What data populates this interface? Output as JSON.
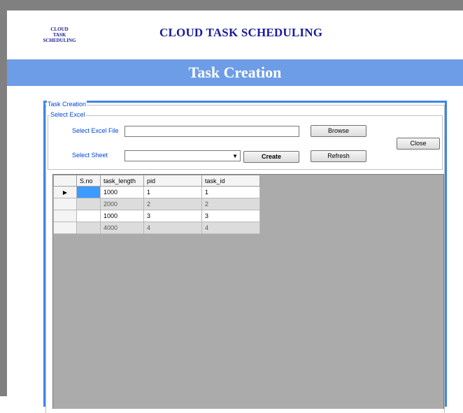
{
  "logo": {
    "lines": [
      "CLOUD",
      "TASK",
      "SCHEDULING"
    ]
  },
  "header": {
    "title": "CLOUD TASK SCHEDULING"
  },
  "banner": {
    "title": "Task Creation"
  },
  "window": {
    "group_title": "Task Creation",
    "select_excel_group": "Select Excel",
    "excel_file_label": "Select Excel File",
    "excel_file_value": "",
    "sheet_label": "Select Sheet",
    "sheet_value": "",
    "browse_label": "Browse",
    "create_label": "Create",
    "refresh_label": "Refresh",
    "close_label": "Close"
  },
  "grid": {
    "columns": [
      "S.no",
      "task_length",
      "pid",
      "task_id"
    ],
    "current_row_marker": "▶",
    "rows": [
      {
        "sno": "",
        "task_length": "1000",
        "pid": "1",
        "task_id": "1"
      },
      {
        "sno": "",
        "task_length": "2000",
        "pid": "2",
        "task_id": "2"
      },
      {
        "sno": "",
        "task_length": "1000",
        "pid": "3",
        "task_id": "3"
      },
      {
        "sno": "",
        "task_length": "4000",
        "pid": "4",
        "task_id": "4"
      }
    ]
  },
  "colors": {
    "banner": "#6d9de6",
    "window_border": "#3f86e6",
    "title_text": "#1a1a9a",
    "selection": "#3d9bff"
  }
}
